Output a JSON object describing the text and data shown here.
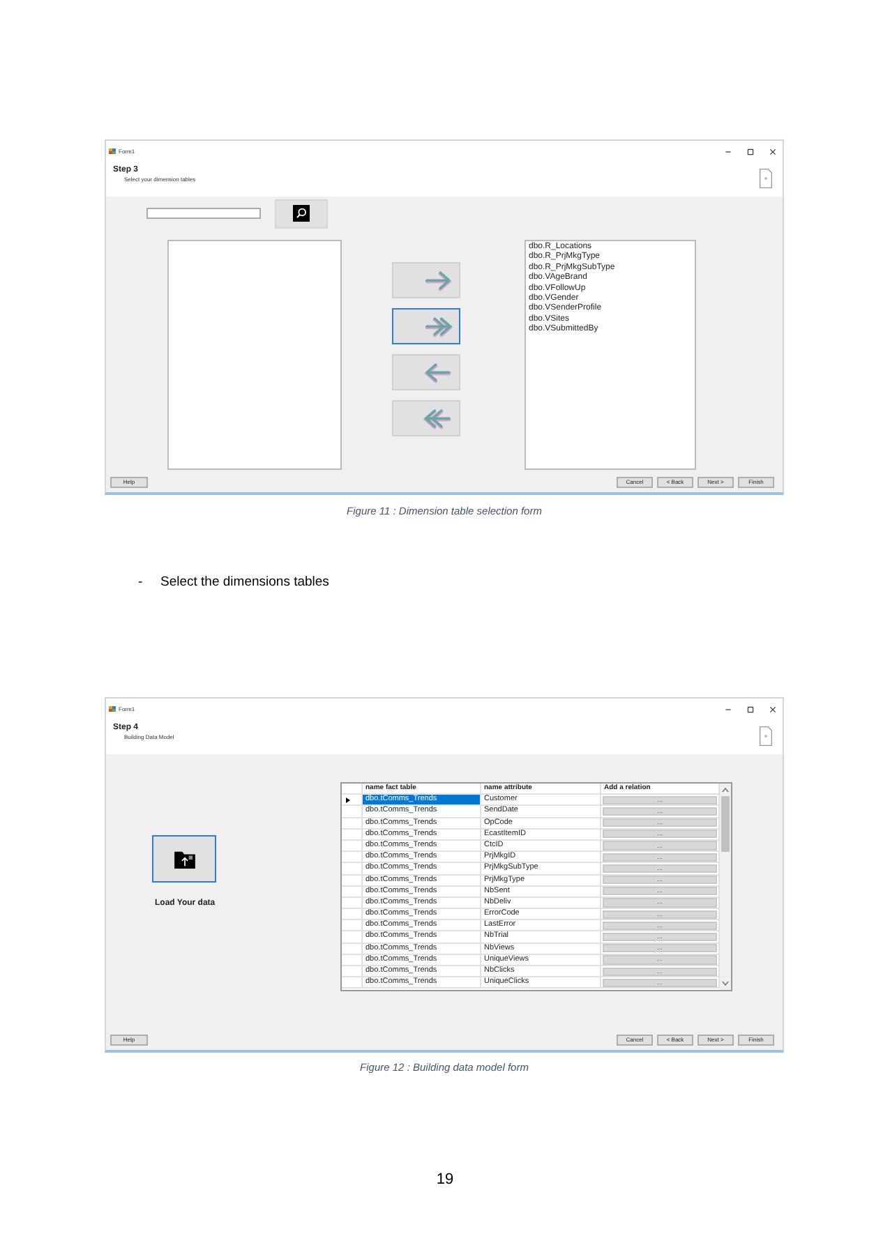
{
  "dimension_form": {
    "window_title": "Form1",
    "step_title": "Step 3",
    "step_subtitle": "Select your dimension tables",
    "transfer_buttons": [
      {
        "kind": "move_right",
        "focused": false
      },
      {
        "kind": "move_all_right",
        "focused": true
      },
      {
        "kind": "move_left",
        "focused": false
      },
      {
        "kind": "move_all_left",
        "focused": false
      }
    ],
    "selected_tables": [
      "dbo.R_Locations",
      "dbo.R_PrjMkgType",
      "dbo.R_PrjMkgSubType",
      "dbo.VAgeBrand",
      "dbo.VFollowUp",
      "dbo.VGender",
      "dbo.VSenderProfile",
      "dbo.VSites",
      "dbo.VSubmittedBy"
    ],
    "help_button": "Help",
    "nav_buttons": [
      "Cancel",
      "< Back",
      "Next >",
      "Finish"
    ]
  },
  "caption_11": "Figure 11 : Dimension table selection form",
  "bullets": [
    {
      "bullet": "-",
      "text": "Select the dimensions tables"
    }
  ],
  "data_model_form": {
    "window_title": "Form1",
    "step_title": "Step 4",
    "step_subtitle": "Building Data Model",
    "load_button": {
      "focused": true
    },
    "load_label": "Load Your data",
    "grid": {
      "columns": [
        "name fact table",
        "name attribute",
        "Add a relation"
      ],
      "rows": [
        {
          "fact_table": "dbo.tComms_Trends",
          "attribute": "Customer",
          "relation": "...",
          "selected": true
        },
        {
          "fact_table": "dbo.tComms_Trends",
          "attribute": "SendDate",
          "relation": "...",
          "selected": false
        },
        {
          "fact_table": "dbo.tComms_Trends",
          "attribute": "OpCode",
          "relation": "...",
          "selected": false
        },
        {
          "fact_table": "dbo.tComms_Trends",
          "attribute": "EcastItemID",
          "relation": "...",
          "selected": false
        },
        {
          "fact_table": "dbo.tComms_Trends",
          "attribute": "CtcID",
          "relation": "...",
          "selected": false
        },
        {
          "fact_table": "dbo.tComms_Trends",
          "attribute": "PrjMkgID",
          "relation": "...",
          "selected": false
        },
        {
          "fact_table": "dbo.tComms_Trends",
          "attribute": "PrjMkgSubType",
          "relation": "...",
          "selected": false
        },
        {
          "fact_table": "dbo.tComms_Trends",
          "attribute": "PrjMkgType",
          "relation": "...",
          "selected": false
        },
        {
          "fact_table": "dbo.tComms_Trends",
          "attribute": "NbSent",
          "relation": "...",
          "selected": false
        },
        {
          "fact_table": "dbo.tComms_Trends",
          "attribute": "NbDeliv",
          "relation": "...",
          "selected": false
        },
        {
          "fact_table": "dbo.tComms_Trends",
          "attribute": "ErrorCode",
          "relation": "...",
          "selected": false
        },
        {
          "fact_table": "dbo.tComms_Trends",
          "attribute": "LastError",
          "relation": "...",
          "selected": false
        },
        {
          "fact_table": "dbo.tComms_Trends",
          "attribute": "NbTrial",
          "relation": "...",
          "selected": false
        },
        {
          "fact_table": "dbo.tComms_Trends",
          "attribute": "NbViews",
          "relation": "...",
          "selected": false
        },
        {
          "fact_table": "dbo.tComms_Trends",
          "attribute": "UniqueViews",
          "relation": "...",
          "selected": false
        },
        {
          "fact_table": "dbo.tComms_Trends",
          "attribute": "NbClicks",
          "relation": "...",
          "selected": false
        },
        {
          "fact_table": "dbo.tComms_Trends",
          "attribute": "UniqueClicks",
          "relation": "...",
          "selected": false
        }
      ]
    },
    "help_button": "Help",
    "nav_buttons": [
      "Cancel",
      "< Back",
      "Next >",
      "Finish"
    ]
  },
  "caption_12": "Figure 12 : Building data model form",
  "page_number": "19"
}
